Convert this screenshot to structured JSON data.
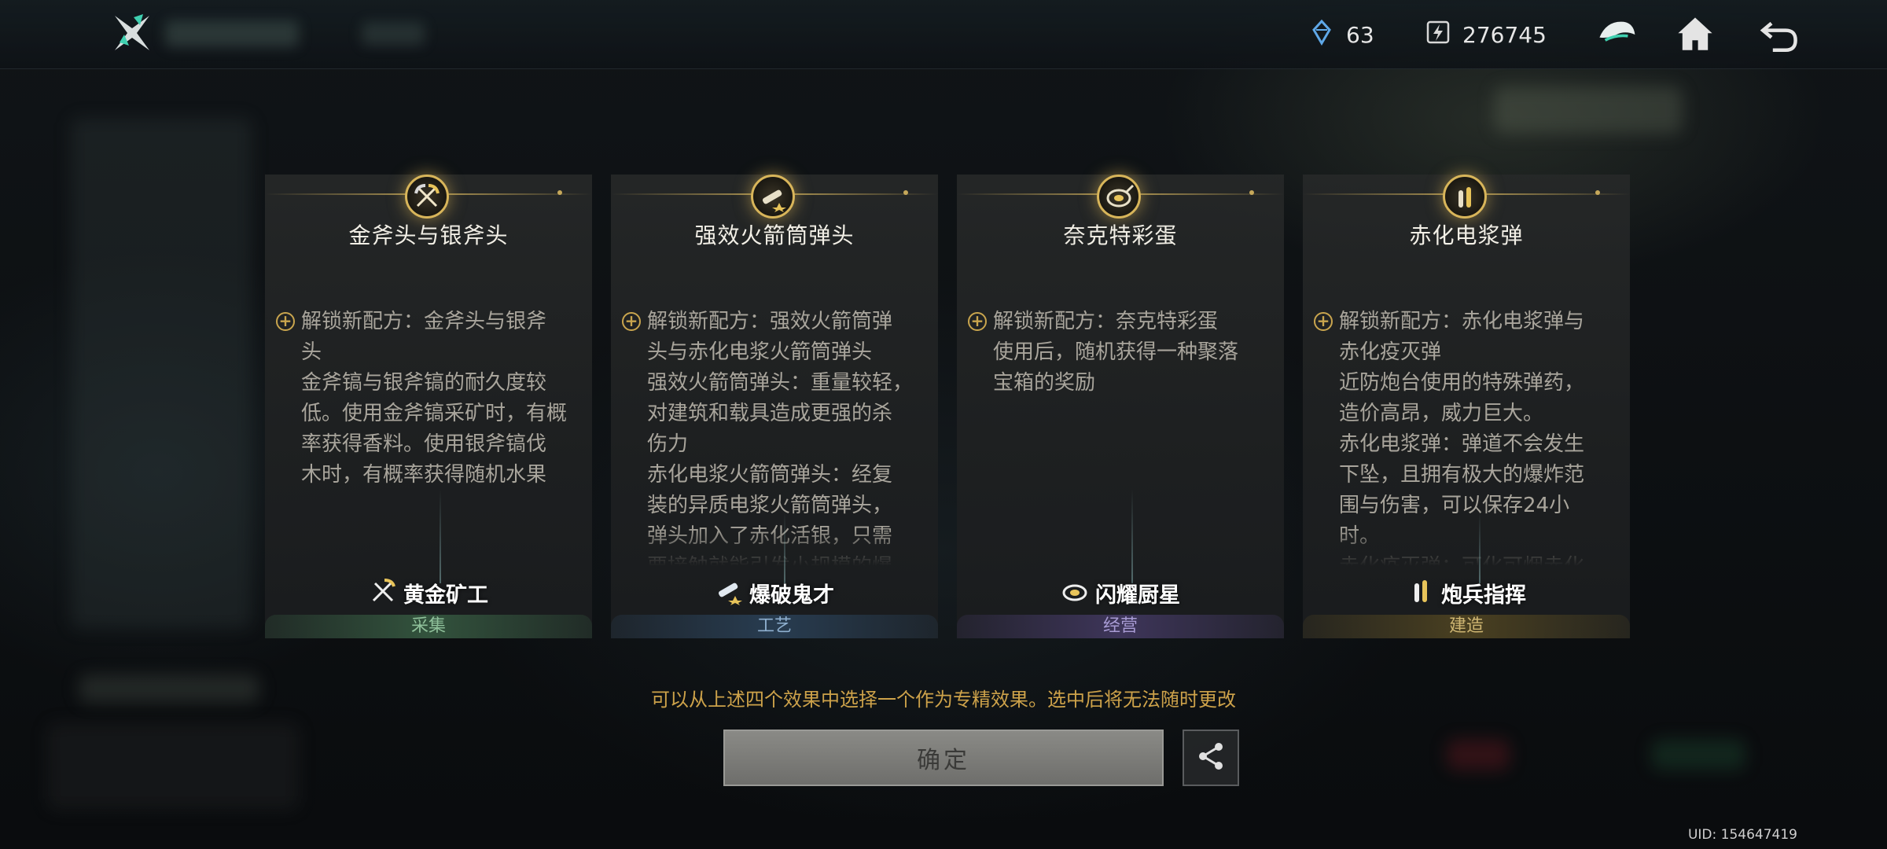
{
  "header": {
    "currency1_value": "63",
    "currency2_value": "276745",
    "icons": [
      "app-logo-icon",
      "crystal-icon",
      "energy-icon",
      "helmet-icon",
      "home-icon",
      "back-icon"
    ]
  },
  "cards": [
    {
      "title": "金斧头与银斧头",
      "body": "解锁新配方：金斧头与银斧\n头\n金斧镐与银斧镐的耐久度较\n低。使用金斧镐采矿时，有概\n率获得香料。使用银斧镐伐\n木时，有概率获得随机水果",
      "trait": "黄金矿工",
      "category": "采集",
      "category_color": "#3d6a4a",
      "category_text_color": "#8fc09a",
      "icon": "pickaxe-icon"
    },
    {
      "title": "强效火箭筒弹头",
      "body": "解锁新配方：强效火箭筒弹\n头与赤化电浆火箭筒弹头\n强效火箭筒弹头：重量较轻，\n对建筑和载具造成更强的杀\n伤力\n赤化电浆火箭筒弹头：经复\n装的异质电浆火箭筒弹头，\n弹头加入了赤化活银，只需\n要接触就能引发小规模的爆",
      "trait": "爆破鬼才",
      "category": "工艺",
      "category_color": "#2e4a66",
      "category_text_color": "#8fb0d0",
      "icon": "rocket-icon"
    },
    {
      "title": "奈克特彩蛋",
      "body": "解锁新配方：奈克特彩蛋\n使用后，随机获得一种聚落\n宝箱的奖励",
      "trait": "闪耀厨星",
      "category": "经营",
      "category_color": "#4a3e6e",
      "category_text_color": "#a89bd4",
      "icon": "egg-pan-icon"
    },
    {
      "title": "赤化电浆弹",
      "body": "解锁新配方：赤化电浆弹与\n赤化疫灭弹\n近防炮台使用的特殊弹药，\n造价高昂，威力巨大。\n赤化电浆弹：弹道不会发生\n下坠，且拥有极大的爆炸范\n围与伤害，可以保存24小\n时。\n赤化疫灭弹：可化可烟赤化",
      "trait": "炮兵指挥",
      "category": "建造",
      "category_color": "#5a4c22",
      "category_text_color": "#cfb672",
      "icon": "bullets-icon"
    }
  ],
  "hint": "可以从上述四个效果中选择一个作为专精效果。选中后将无法随时更改",
  "confirm_label": "确定",
  "uid": "UID: 154647419"
}
